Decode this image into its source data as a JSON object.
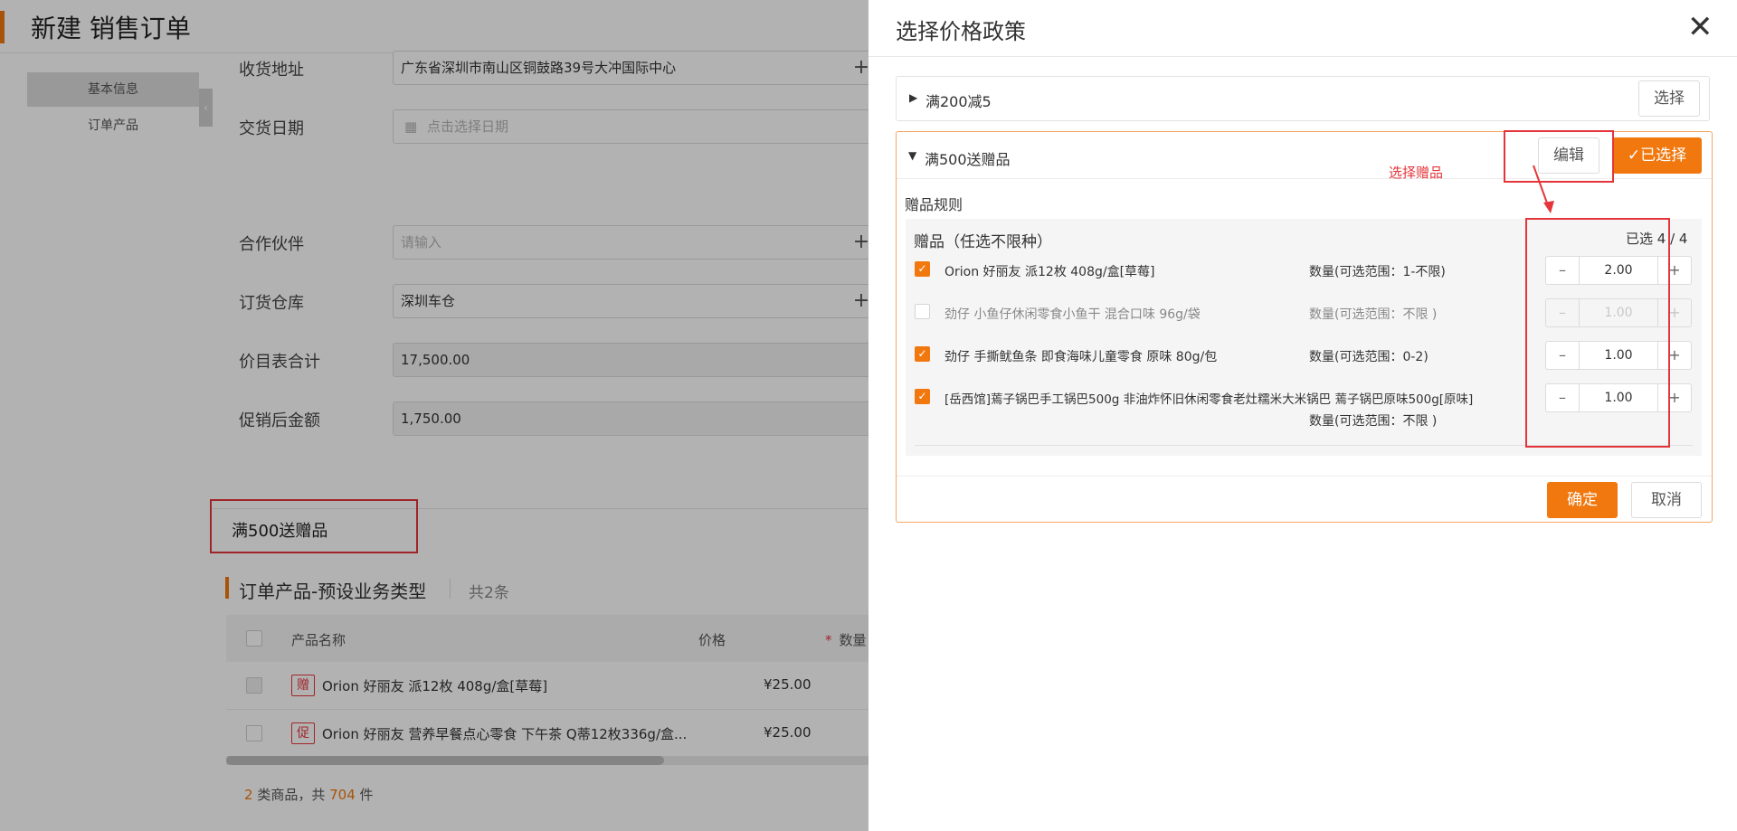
{
  "page": {
    "title": "新建 销售订单",
    "sidebar": [
      {
        "label": "基本信息",
        "active": true
      },
      {
        "label": "订单产品",
        "active": false
      }
    ],
    "form": {
      "address_label": "收货地址",
      "address_value": "广东省深圳市南山区铜鼓路39号大冲国际中心",
      "date_label": "交货日期",
      "date_placeholder": "点击选择日期",
      "partner_label": "合作伙伴",
      "partner_placeholder": "请输入",
      "warehouse_label": "订货仓库",
      "warehouse_value": "深圳车仓",
      "pricelist_total_label": "价目表合计",
      "pricelist_total_value": "17,500.00",
      "after_promo_label": "促销后金额",
      "after_promo_value": "1,750.00"
    },
    "applied_promo": "满500送赠品",
    "products_section": {
      "title": "订单产品-预设业务类型",
      "count": "共2条",
      "columns": [
        "产品名称",
        "价格",
        "数量"
      ],
      "rows": [
        {
          "tag": "赠",
          "name": "Orion 好丽友 派12枚 408g/盒[草莓]",
          "price": "¥25.00"
        },
        {
          "tag": "促",
          "name": "Orion 好丽友 营养早餐点心零食 下午茶 Q蒂12枚336g/盒...",
          "price": "¥25.00"
        }
      ],
      "summary": {
        "kinds": "2",
        "kinds_unit": "类商品，共",
        "qty": "704",
        "qty_unit": "件"
      }
    }
  },
  "drawer": {
    "title": "选择价格政策",
    "close_icon": "close-icon",
    "policies": [
      {
        "name": "满200减5",
        "expanded": false,
        "select_label": "选择"
      },
      {
        "name": "满500送赠品",
        "expanded": true,
        "edit_label": "编辑",
        "selected_label": "已选择"
      }
    ],
    "gift_rules_label": "赠品规则",
    "gift_header": "赠品（任选不限种）",
    "selected_count": "已选 4 / 4",
    "gifts": [
      {
        "name": "Orion 好丽友 派12枚 408g/盒[草莓]",
        "qty_range": "数量(可选范围：1-不限)",
        "qty": "2.00",
        "checked": true,
        "disabled": false
      },
      {
        "name": "劲仔 小鱼仔休闲零食小鱼干 混合口味 96g/袋",
        "qty_range": "数量(可选范围：不限 )",
        "qty": "1.00",
        "checked": false,
        "disabled": true
      },
      {
        "name": "劲仔 手撕鱿鱼条 即食海味儿童零食 原味 80g/包",
        "qty_range": "数量(可选范围：0-2)",
        "qty": "1.00",
        "checked": true,
        "disabled": false
      },
      {
        "name": "[岳西馆]蔫子锅巴手工锅巴500g 非油炸怀旧休闲零食老灶糯米大米锅巴 蔫子锅巴原味500g[原味]",
        "qty_range": "数量(可选范围：不限 )",
        "qty": "1.00",
        "checked": true,
        "disabled": false
      }
    ],
    "annotation": "选择赠品",
    "confirm_label": "确定",
    "cancel_label": "取消",
    "accent_color": "#f0780f",
    "annotation_color": "#e5353a"
  }
}
